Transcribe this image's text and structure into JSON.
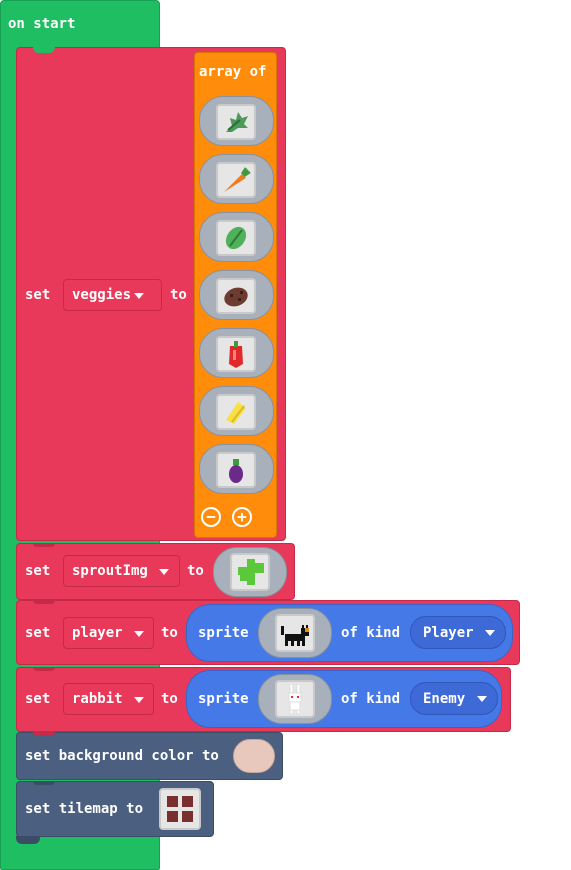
{
  "on_start": {
    "label": "on start"
  },
  "veggies": {
    "set_label": "set",
    "var_name": "veggies",
    "to_label": "to",
    "array_label": "array of",
    "items": [
      "leaf-sprite-icon",
      "carrot-sprite-icon",
      "lettuce-sprite-icon",
      "potato-sprite-icon",
      "pepper-sprite-icon",
      "corn-sprite-icon",
      "eggplant-sprite-icon"
    ],
    "remove_label": "−",
    "add_label": "+"
  },
  "sprout": {
    "set_label": "set",
    "var_name": "sproutImg",
    "to_label": "to",
    "image_icon": "sprout-sprite-icon"
  },
  "player": {
    "set_label": "set",
    "var_name": "player",
    "to_label": "to",
    "sprite_label": "sprite",
    "image_icon": "cat-sprite-icon",
    "of_kind_label": "of kind",
    "kind": "Player"
  },
  "rabbit": {
    "set_label": "set",
    "var_name": "rabbit",
    "to_label": "to",
    "sprite_label": "sprite",
    "image_icon": "rabbit-sprite-icon",
    "of_kind_label": "of kind",
    "kind": "Enemy"
  },
  "background": {
    "label": "set background color to",
    "color": "#e8c8bc"
  },
  "tilemap": {
    "label": "set tilemap to",
    "icon": "tilemap-icon"
  },
  "colors": {
    "event": "#1fbe63",
    "variables": "#e8395a",
    "arrays": "#ff8c0a",
    "sprites": "#4679e8",
    "scene": "#4b5f80"
  }
}
